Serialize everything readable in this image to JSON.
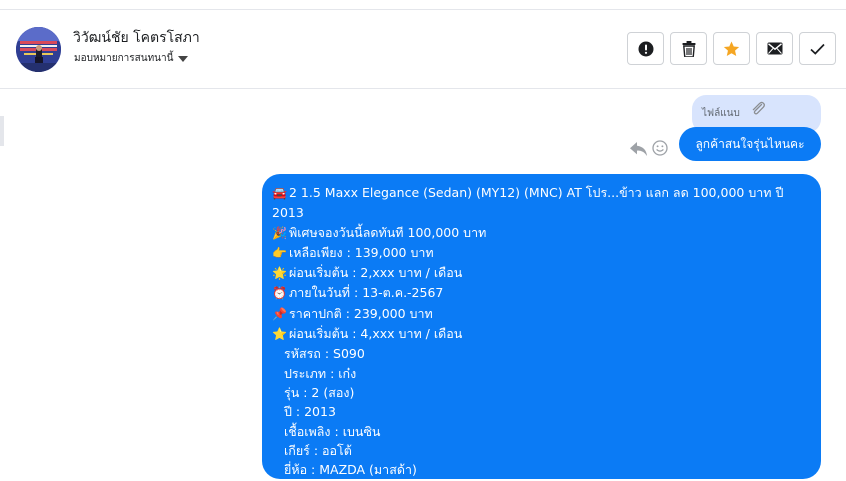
{
  "header": {
    "contact_name": "วิวัฒน์ชัย โคตรโสภา",
    "assign_label": "มอบหมายการสนทนานี้"
  },
  "attachment": {
    "label": "ไฟล์แนบ"
  },
  "messages": {
    "short": "ลูกค้าสนใจรุ่นไหนคะ",
    "lines": [
      {
        "emoji": "🚘",
        "text": "2 1.5 Maxx Elegance (Sedan) (MY12) (MNC) AT โปร...ข้าว แลก ลด 100,000 บาท ปี 2013"
      },
      {
        "emoji": "🎉",
        "text": "พิเศษจองวันนี้ลดทันที 100,000 บาท"
      },
      {
        "emoji": "👉",
        "text": "เหลือเพียง : 139,000 บาท"
      },
      {
        "emoji": "🌟",
        "text": "ผ่อนเริ่มต้น : 2,xxx บาท / เดือน"
      },
      {
        "emoji": "⏰",
        "text": "ภายในวันที่ : 13-ต.ค.-2567"
      },
      {
        "emoji": "📌",
        "text": "ราคาปกติ : 239,000 บาท"
      },
      {
        "emoji": "⭐",
        "text": "ผ่อนเริ่มต้น : 4,xxx บาท / เดือน"
      }
    ],
    "details": [
      "รหัสรถ : S090",
      "ประเภท : เก๋ง",
      "รุ่น : 2 (สอง)",
      "ปี : 2013",
      "เชื้อเพลิง : เบนซิน",
      "เกียร์ : ออโต้",
      "ยี่ห้อ : MAZDA (มาสด้า)"
    ]
  },
  "colors": {
    "bubble": "#0b7bf5",
    "attachment_bg": "#d8e4fd",
    "star": "#f5a623"
  }
}
